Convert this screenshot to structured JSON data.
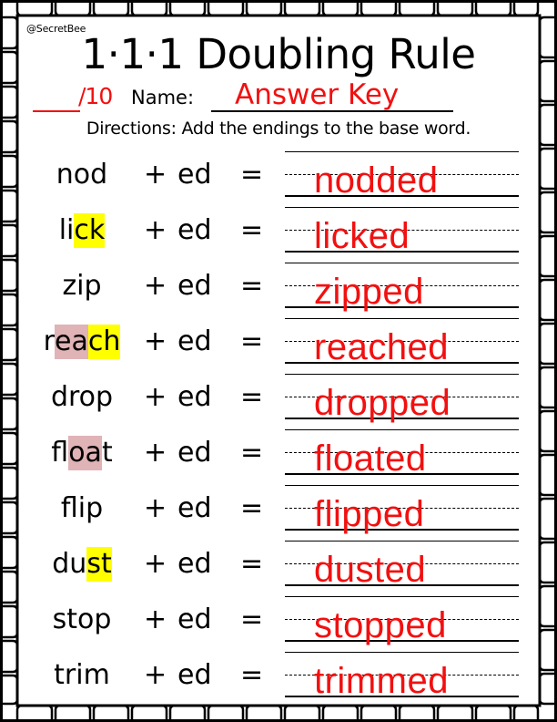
{
  "worksheet": {
    "credit": "@SecretBee",
    "title": "1·1·1 Doubling Rule",
    "score_total": "/10",
    "name_label": "Name:",
    "name_value": "Answer Key",
    "directions": "Directions: Add the endings to the base word.",
    "colors": {
      "answer": "#f21010",
      "highlight_yellow": "#ffff00",
      "highlight_pink": "#e0b3b6"
    },
    "operator_plus": "+",
    "operator_equals": "=",
    "rows": [
      {
        "base_segments": [
          {
            "text": "nod",
            "hl": ""
          }
        ],
        "ending": "ed",
        "answer": "nodded"
      },
      {
        "base_segments": [
          {
            "text": "li",
            "hl": ""
          },
          {
            "text": "ck",
            "hl": "yellow"
          }
        ],
        "ending": "ed",
        "answer": "licked"
      },
      {
        "base_segments": [
          {
            "text": "zip",
            "hl": ""
          }
        ],
        "ending": "ed",
        "answer": "zipped"
      },
      {
        "base_segments": [
          {
            "text": "r",
            "hl": ""
          },
          {
            "text": "ea",
            "hl": "pink"
          },
          {
            "text": "ch",
            "hl": "yellow"
          }
        ],
        "ending": "ed",
        "answer": "reached"
      },
      {
        "base_segments": [
          {
            "text": "drop",
            "hl": ""
          }
        ],
        "ending": "ed",
        "answer": "dropped"
      },
      {
        "base_segments": [
          {
            "text": "fl",
            "hl": ""
          },
          {
            "text": "oa",
            "hl": "pink"
          },
          {
            "text": "t",
            "hl": ""
          }
        ],
        "ending": "ed",
        "answer": "floated"
      },
      {
        "base_segments": [
          {
            "text": "flip",
            "hl": ""
          }
        ],
        "ending": "ed",
        "answer": "flipped"
      },
      {
        "base_segments": [
          {
            "text": "du",
            "hl": ""
          },
          {
            "text": "st",
            "hl": "yellow"
          }
        ],
        "ending": "ed",
        "answer": "dusted"
      },
      {
        "base_segments": [
          {
            "text": "stop",
            "hl": ""
          }
        ],
        "ending": "ed",
        "answer": "stopped"
      },
      {
        "base_segments": [
          {
            "text": "trim",
            "hl": ""
          }
        ],
        "ending": "ed",
        "answer": "trimmed"
      }
    ]
  }
}
